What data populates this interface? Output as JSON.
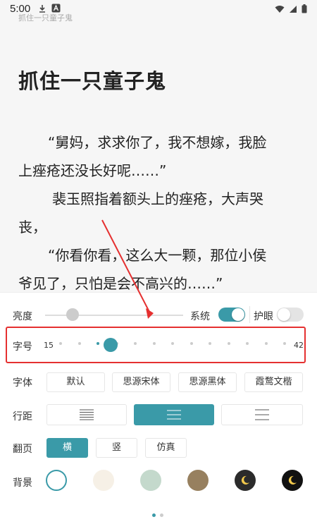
{
  "status": {
    "time": "5:00"
  },
  "breadcrumb": "抓住一只童子鬼",
  "book": {
    "title": "抓住一只童子鬼",
    "paragraphs": [
      "“舅妈，求求你了，我不想嫁，我脸",
      "上痤疮还没长好呢……”",
      "裴玉照指着额头上的痤疮，大声哭",
      "丧，",
      "“你看你看，这么大一颗，那位小侯",
      "爷见了，只怕是会不高兴的……”"
    ]
  },
  "settings": {
    "brightness": {
      "label": "亮度",
      "level": 0.2
    },
    "system": {
      "label": "系统",
      "on": true
    },
    "eye_care": {
      "label": "护眼",
      "on": false
    },
    "font_size": {
      "label": "字号",
      "min": "15",
      "max": "42",
      "value": 21
    },
    "font": {
      "label": "字体",
      "options": [
        "默认",
        "思源宋体",
        "思源黑体",
        "霞鹜文楷"
      ],
      "selected": 0
    },
    "line_spacing": {
      "label": "行距",
      "options": [
        "dense-lines-icon",
        "medium-lines-icon",
        "loose-lines-icon"
      ],
      "selected": 1
    },
    "page_turn": {
      "label": "翻页",
      "options": [
        "横",
        "竖",
        "仿真"
      ],
      "selected": 0
    },
    "background": {
      "label": "背景",
      "colors": [
        "#ffffff",
        "#f6f0e6",
        "#c4d9cc",
        "#97805f",
        "#2b2b2b",
        "#111111"
      ],
      "selected": 0
    }
  },
  "colors": {
    "accent": "#3a9aa8",
    "highlight": "#e53030"
  }
}
